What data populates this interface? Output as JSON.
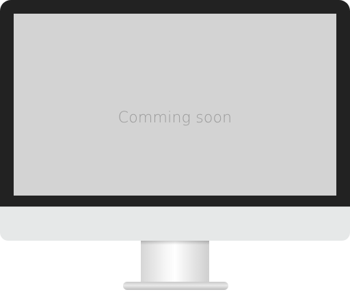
{
  "screen": {
    "message": "Comming soon"
  },
  "colors": {
    "bezel": "#222222",
    "screen": "#d3d3d3",
    "message_text": "#9a9a9a",
    "chin": "#e6e8e8"
  }
}
